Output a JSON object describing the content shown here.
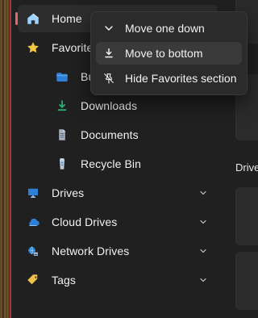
{
  "sidebar": {
    "items": [
      {
        "label": "Home"
      },
      {
        "label": "Favorites"
      },
      {
        "label": "Bu"
      },
      {
        "label": "Downloads"
      },
      {
        "label": "Documents"
      },
      {
        "label": "Recycle Bin"
      },
      {
        "label": "Drives"
      },
      {
        "label": "Cloud Drives"
      },
      {
        "label": "Network Drives"
      },
      {
        "label": "Tags"
      }
    ]
  },
  "context_menu": {
    "items": [
      {
        "label": "Move one down",
        "icon": "chevron-down-icon"
      },
      {
        "label": "Move to bottom",
        "icon": "move-to-bottom-icon"
      },
      {
        "label": "Hide Favorites section",
        "icon": "hide-pin-icon"
      }
    ]
  },
  "right_pane": {
    "section_label": "Drive"
  },
  "colors": {
    "background": "#202020",
    "menu_bg": "#2b2b2b",
    "menu_hover": "#3a3a3a",
    "text": "#f2f2f2",
    "active_indicator": "#e06b6b",
    "folder_blue": "#2f7fd6",
    "download_green": "#2bb673",
    "favorites_yellow": "#f4c542",
    "tags_yellow": "#f0c14b"
  }
}
